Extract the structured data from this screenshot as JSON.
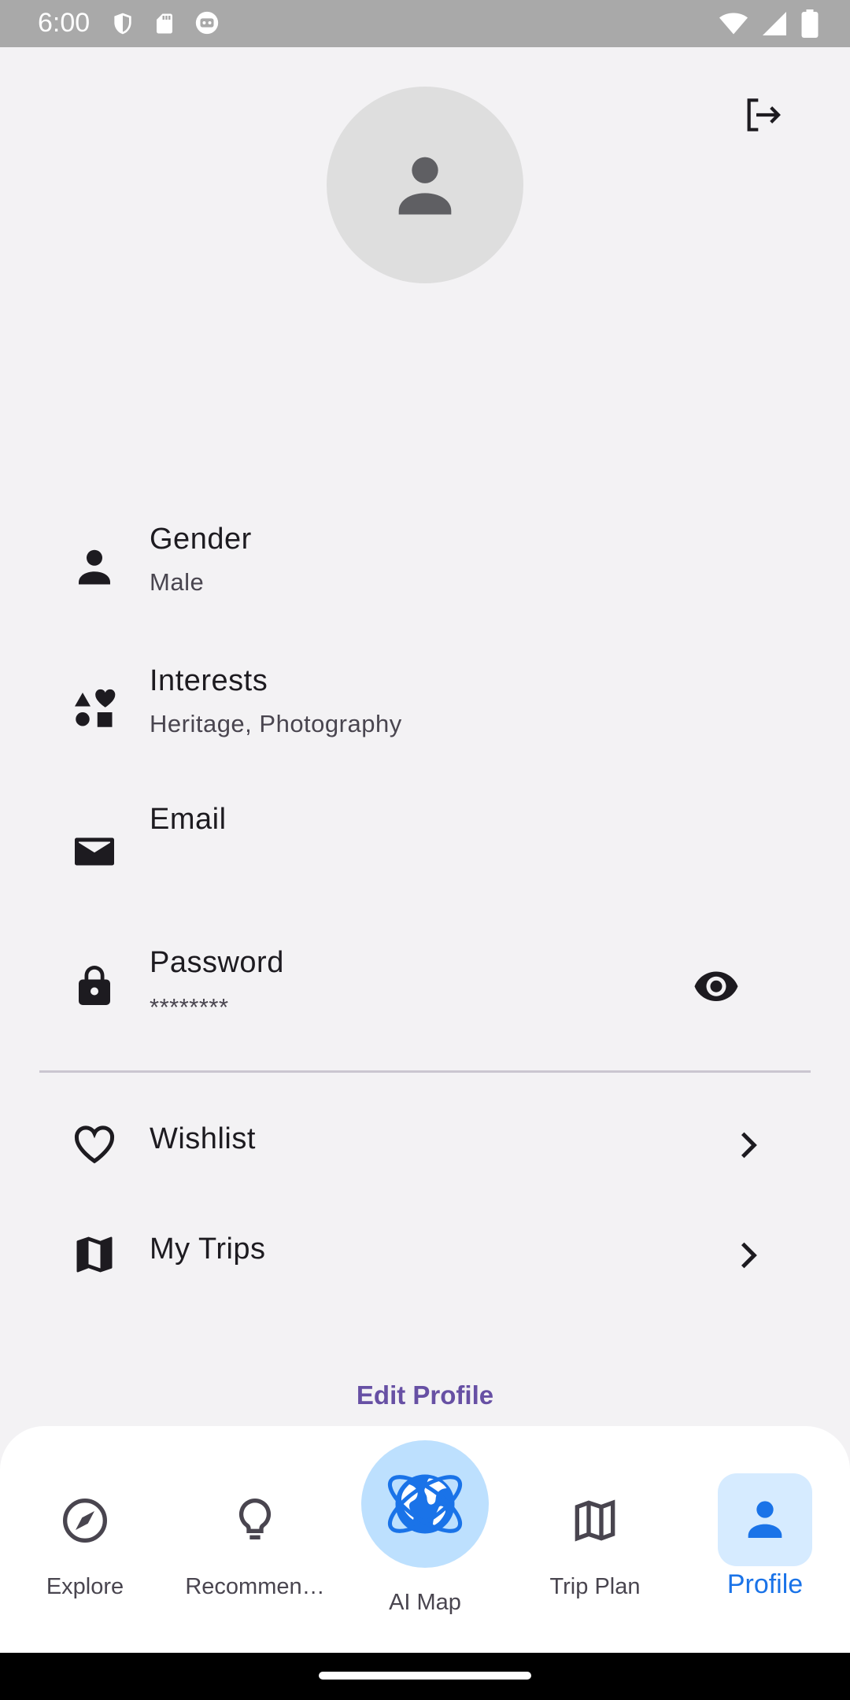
{
  "status_bar": {
    "time": "6:00",
    "left_icons": [
      "shield-icon",
      "sd-card-icon",
      "robot-icon"
    ],
    "right_icons": [
      "wifi-icon",
      "signal-icon",
      "battery-icon"
    ]
  },
  "header": {
    "logout_icon": "logout-icon"
  },
  "avatar": {
    "icon": "person-icon"
  },
  "profile_fields": [
    {
      "title": "Gender",
      "value": "Male",
      "icon": "person-icon"
    },
    {
      "title": "Interests",
      "value": "Heritage, Photography",
      "icon": "category-icon"
    },
    {
      "title": "Email",
      "value": "",
      "icon": "mail-icon"
    },
    {
      "title": "Password",
      "value": "********",
      "icon": "lock-icon"
    }
  ],
  "links": [
    {
      "label": "Wishlist",
      "icon": "heart-icon"
    },
    {
      "label": "My Trips",
      "icon": "map-icon"
    }
  ],
  "edit_profile_label": "Edit Profile",
  "bottom_nav": {
    "items": [
      {
        "label": "Explore",
        "icon": "compass-icon"
      },
      {
        "label": "Recommen…",
        "icon": "lightbulb-icon"
      },
      {
        "label": "AI Map",
        "icon": "globe-icon"
      },
      {
        "label": "Trip Plan",
        "icon": "map-icon"
      },
      {
        "label": "Profile",
        "icon": "person-icon",
        "selected": true
      }
    ]
  },
  "colors": {
    "accent": "#1a73e8",
    "edit_link": "#6750a4",
    "fab_bg": "#bde0fe",
    "selected_pill": "#d6ebff"
  }
}
